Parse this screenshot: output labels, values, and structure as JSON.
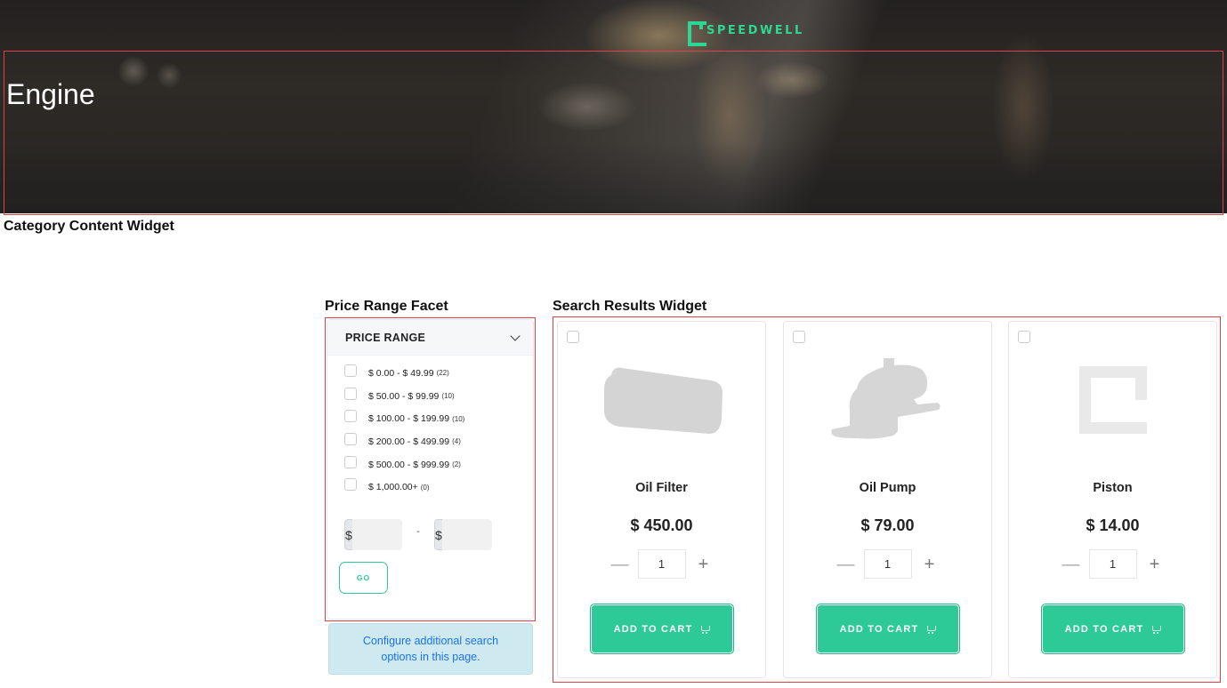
{
  "brand": {
    "name": "SPEEDWELL",
    "accent_color": "#2dd693"
  },
  "hero": {
    "title": "Engine"
  },
  "category_widget": {
    "label": "Category Content Widget"
  },
  "price_facet": {
    "section_label": "Price Range Facet",
    "title": "PRICE RANGE",
    "toggle_icon": "chevron-down-icon",
    "options": [
      {
        "label": "$ 0.00 - $ 49.99",
        "count": "(22)",
        "checked": false
      },
      {
        "label": "$ 50.00 - $ 99.99",
        "count": "(10)",
        "checked": false
      },
      {
        "label": "$ 100.00 - $ 199.99",
        "count": "(10)",
        "checked": false
      },
      {
        "label": "$ 200.00 - $ 499.99",
        "count": "(4)",
        "checked": false
      },
      {
        "label": "$ 500.00 - $ 999.99",
        "count": "(2)",
        "checked": false
      },
      {
        "label": "$ 1,000.00+",
        "count": "(0)",
        "checked": false
      }
    ],
    "min_prefix": "$",
    "max_prefix": "$",
    "min_value": "",
    "max_value": "",
    "separator": "-",
    "go_label": "GO"
  },
  "config_note": {
    "text": "Configure additional search options in this page."
  },
  "search_results": {
    "section_label": "Search Results Widget",
    "button_color": "#2dc996",
    "products": [
      {
        "name": "Oil Filter",
        "price": "$ 450.00",
        "quantity": "1",
        "image": "oil-filter-image",
        "cta": "ADD TO CART"
      },
      {
        "name": "Oil Pump",
        "price": "$ 79.00",
        "quantity": "1",
        "image": "oil-pump-image",
        "cta": "ADD TO CART"
      },
      {
        "name": "Piston",
        "price": "$ 14.00",
        "quantity": "1",
        "image": "placeholder-logo-image",
        "cta": "ADD TO CART"
      }
    ],
    "qty_minus": "—",
    "qty_plus": "+"
  }
}
